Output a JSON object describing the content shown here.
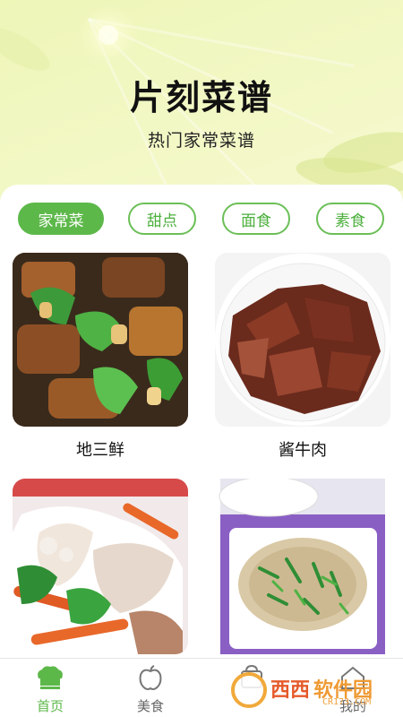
{
  "app": {
    "title": "片刻菜谱",
    "subtitle": "热门家常菜谱"
  },
  "tabs": [
    {
      "label": "家常菜",
      "active": true
    },
    {
      "label": "甜点",
      "active": false
    },
    {
      "label": "面食",
      "active": false
    },
    {
      "label": "素食",
      "active": false
    }
  ],
  "recipes": [
    {
      "name": "地三鲜",
      "image": "stir-fried-potato-eggplant-pepper-photo"
    },
    {
      "name": "酱牛肉",
      "image": "braised-beef-slices-photo"
    },
    {
      "name": "",
      "image": "stir-fried-squid-vegetables-photo"
    },
    {
      "name": "",
      "image": "shredded-tofu-pepper-plate-photo"
    }
  ],
  "bottom_nav": [
    {
      "label": "首页",
      "icon": "chef-hat-icon",
      "active": true
    },
    {
      "label": "美食",
      "icon": "apple-icon",
      "active": false
    },
    {
      "label": "",
      "icon": "bag-icon",
      "active": false
    },
    {
      "label": "我的",
      "icon": "home-icon",
      "active": false
    }
  ],
  "watermark": {
    "text1": "西西",
    "text2": "软件园",
    "url": "CR173.COM"
  },
  "colors": {
    "accent": "#5db84a",
    "hero_bg": "#f2f7c6"
  }
}
